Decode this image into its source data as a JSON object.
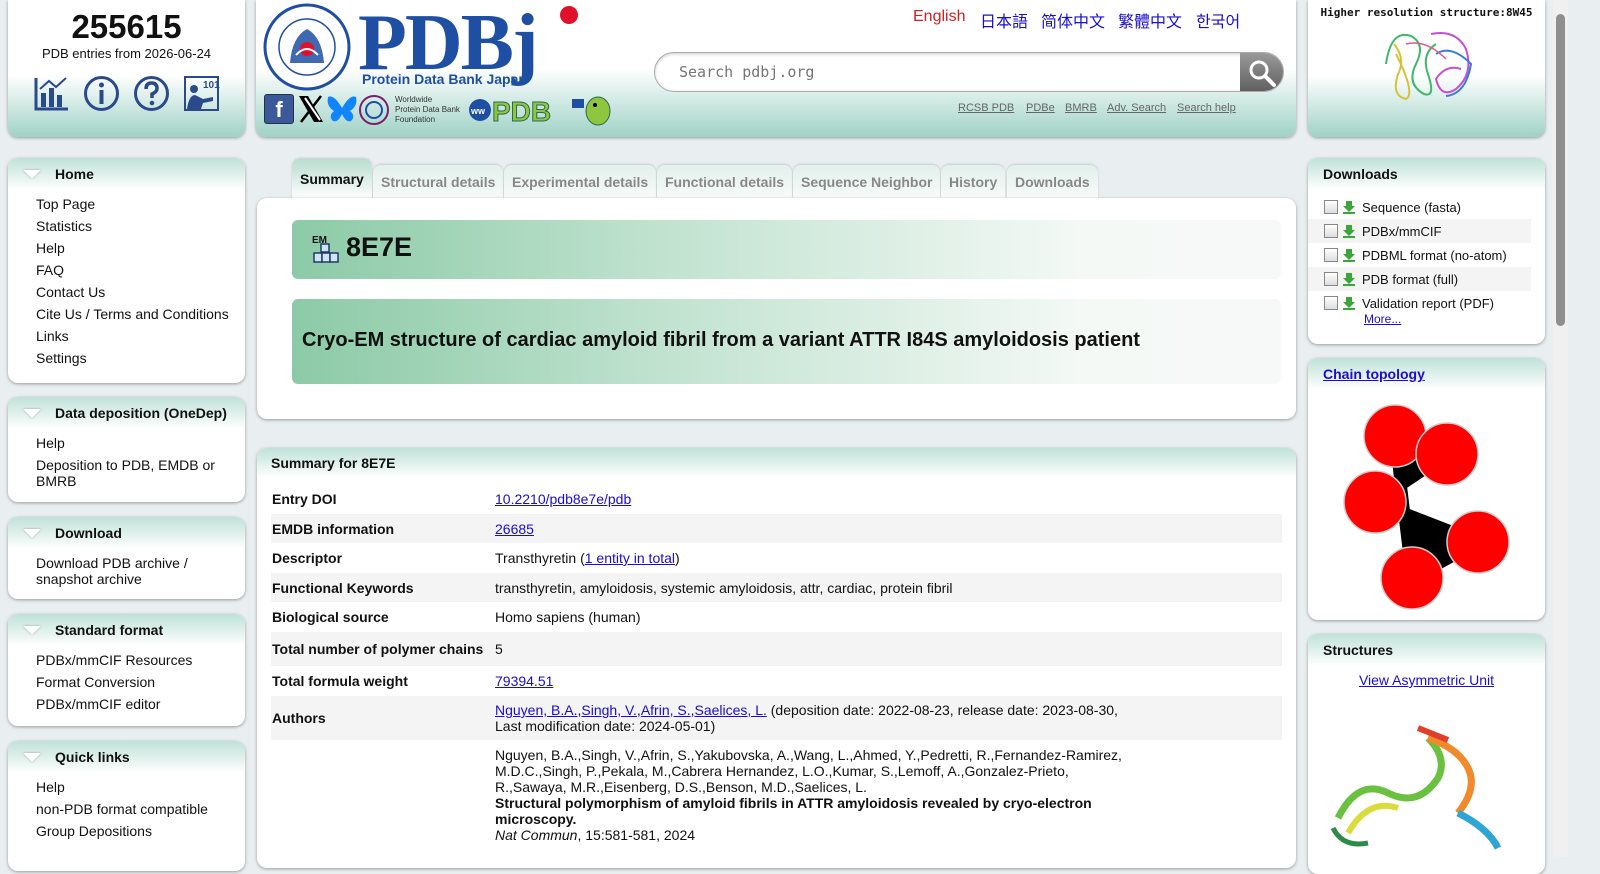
{
  "counter": {
    "count": "255615",
    "subtitle": "PDB entries from 2026-06-24"
  },
  "nav_icons": [
    "statistics-icon",
    "info-icon",
    "help-icon",
    "tutorial-101-icon"
  ],
  "header": {
    "logo_text": "PDBj",
    "logo_subtitle": "Protein Data Bank Japan",
    "seal_text": "PROTEIN DATA BANK JAPAN · THE UNIVERSITY OF OSAKA",
    "wwpdb_foundation": [
      "Worldwide",
      "Protein Data Bank",
      "Foundation"
    ],
    "wwpdb_logo_text": "WORLDWIDE PDB PROTEIN DATA BANK",
    "languages": [
      "English",
      "日本語",
      "简体中文",
      "繁體中文",
      "한국어"
    ],
    "search_placeholder": "Search pdbj.org",
    "links": [
      "RCSB PDB",
      "PDBe",
      "BMRB",
      "Adv. Search",
      "Search help"
    ]
  },
  "hires": {
    "title": "Higher resolution structure:8W45"
  },
  "left_menu": [
    {
      "title": "Home",
      "items": [
        "Top Page",
        "Statistics",
        "Help",
        "FAQ",
        "Contact Us",
        "Cite Us / Terms and Conditions",
        "Links",
        "Settings"
      ]
    },
    {
      "title": "Data deposition (OneDep)",
      "items": [
        "Help",
        "Deposition to PDB, EMDB or BMRB"
      ]
    },
    {
      "title": "Download",
      "items": [
        "Download PDB archive / snapshot archive"
      ]
    },
    {
      "title": "Standard format",
      "items": [
        "PDBx/mmCIF Resources",
        "Format Conversion",
        "PDBx/mmCIF editor"
      ]
    },
    {
      "title": "Quick links",
      "items": [
        "Help",
        "non-PDB format compatible",
        "Group Depositions"
      ]
    }
  ],
  "tabs": [
    "Summary",
    "Structural details",
    "Experimental details",
    "Functional details",
    "Sequence Neighbor",
    "History",
    "Downloads"
  ],
  "entry": {
    "method_icon_label": "EM",
    "id": "8E7E",
    "title": "Cryo-EM structure of cardiac amyloid fibril from a variant ATTR I84S amyloidosis patient"
  },
  "summary": {
    "heading": "Summary for 8E7E",
    "entry_doi_label": "Entry DOI",
    "entry_doi": "10.2210/pdb8e7e/pdb",
    "emdb_label": "EMDB information",
    "emdb": "26685",
    "descriptor_label": "Descriptor",
    "descriptor": "Transthyretin (",
    "descriptor_link": "1 entity in total",
    "descriptor_end": ")",
    "keywords_label": "Functional Keywords",
    "keywords": "transthyretin, amyloidosis, systemic amyloidosis, attr, cardiac, protein fibril",
    "source_label": "Biological source",
    "source": "Homo sapiens (human)",
    "chains_label": "Total number of polymer chains",
    "chains": "5",
    "weight_label": "Total formula weight",
    "weight": "79394.51",
    "authors_label": "Authors",
    "authors": [
      "Nguyen, B.A.",
      "Singh, V.",
      "Afrin, S.",
      "Saelices, L."
    ],
    "author_separators": [
      ",",
      ",",
      ","
    ],
    "dates": " (deposition date: 2022-08-23, release date: 2023-08-30, Last modification date: 2024-05-01)",
    "citation_authors": "Nguyen, B.A.,Singh, V.,Afrin, S.,Yakubovska, A.,Wang, L.,Ahmed, Y.,Pedretti, R.,Fernandez-Ramirez, M.D.C.,Singh, P.,Pekala, M.,Cabrera Hernandez, L.O.,Kumar, S.,Lemoff, A.,Gonzalez-Prieto, R.,Sawaya, M.R.,Eisenberg, D.S.,Benson, M.D.,Saelices, L.",
    "citation_title": "Structural polymorphism of amyloid fibrils in ATTR amyloidosis revealed by cryo-electron microscopy.",
    "citation_journal": "Nat Commun",
    "citation_rest": ", 15:581-581, 2024"
  },
  "downloads": {
    "title": "Downloads",
    "items": [
      "Sequence (fasta)",
      "PDBx/mmCIF",
      "PDBML format (no-atom)",
      "PDB format (full)",
      "Validation report (PDF)"
    ],
    "more": "More..."
  },
  "chain_topology": {
    "title": "Chain topology",
    "color": "#ff0000"
  },
  "structures": {
    "title": "Structures",
    "link": "View Asymmetric Unit"
  },
  "colors": {
    "accent_green": "#9fd2c6",
    "link": "#1a0dcc",
    "lang_active": "#cc2222"
  }
}
